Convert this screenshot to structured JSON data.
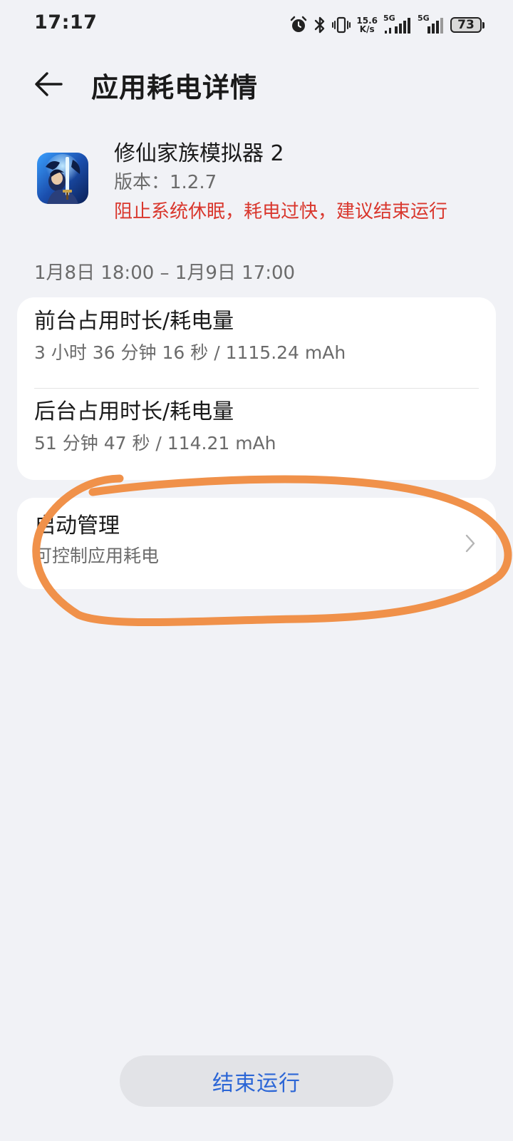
{
  "status_bar": {
    "time": "17:17",
    "net_speed_value": "15.6",
    "net_speed_unit": "K/s",
    "signal1_label": "5G",
    "signal2_label": "5G",
    "battery_level": "73"
  },
  "header": {
    "title": "应用耗电详情",
    "back_icon": "arrow-left-icon"
  },
  "app": {
    "name": "修仙家族模拟器 2",
    "version": "版本：1.2.7",
    "warning": "阻止系统休眠，耗电过快，建议结束运行",
    "warning_color": "#d9372d"
  },
  "date_range": "1月8日 18:00 – 1月9日 17:00",
  "usage": {
    "foreground_title": "前台占用时长/耗电量",
    "foreground_value": "3 小时 36 分钟 16 秒 / 1115.24 mAh",
    "background_title": "后台占用时长/耗电量",
    "background_value": "51 分钟 47 秒 / 114.21 mAh"
  },
  "launch": {
    "title": "启动管理",
    "subtitle": "可控制应用耗电",
    "chevron_icon": "chevron-right-icon"
  },
  "end_button": {
    "label": "结束运行",
    "color": "#2c66d6"
  },
  "annotation_color": "#f0914a"
}
